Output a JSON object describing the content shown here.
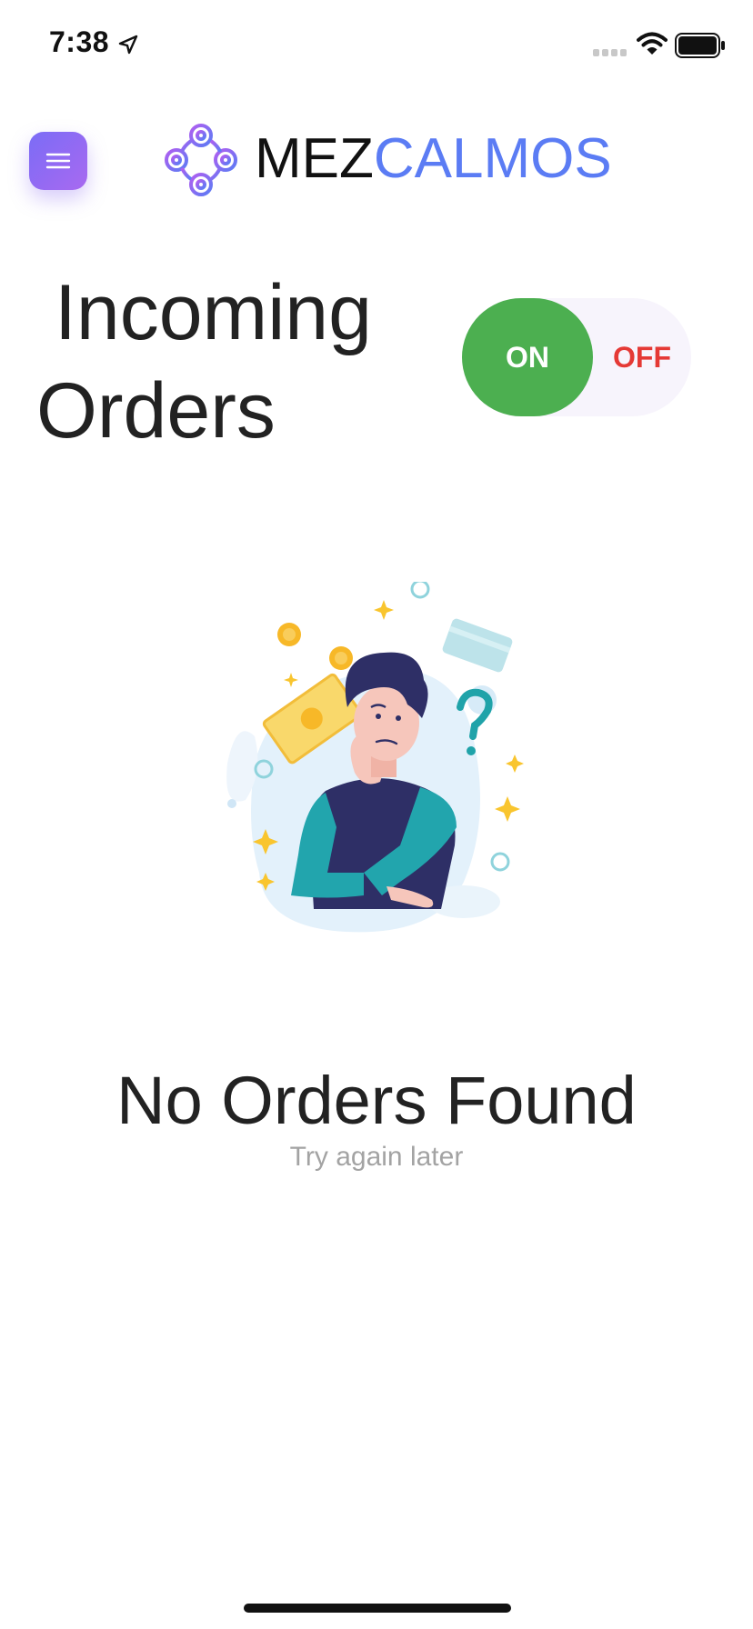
{
  "status_bar": {
    "time": "7:38"
  },
  "header": {
    "menu_icon": "hamburger-menu-icon",
    "logo_icon": "mezcalmos-logo-icon",
    "brand_part1": "MEZ",
    "brand_part2": "CALMOS",
    "brand_color_dark": "#111111",
    "brand_color_accent": "#5b7cf4"
  },
  "page": {
    "title_line1": "Incoming",
    "title_line2": "Orders"
  },
  "toggle": {
    "on_label": "ON",
    "off_label": "OFF",
    "state": "on",
    "on_color": "#4caf50",
    "off_color": "#e53935"
  },
  "empty_state": {
    "illustration": "thinking-man-money-illustration",
    "title": "No Orders Found",
    "subtitle": "Try again later"
  }
}
